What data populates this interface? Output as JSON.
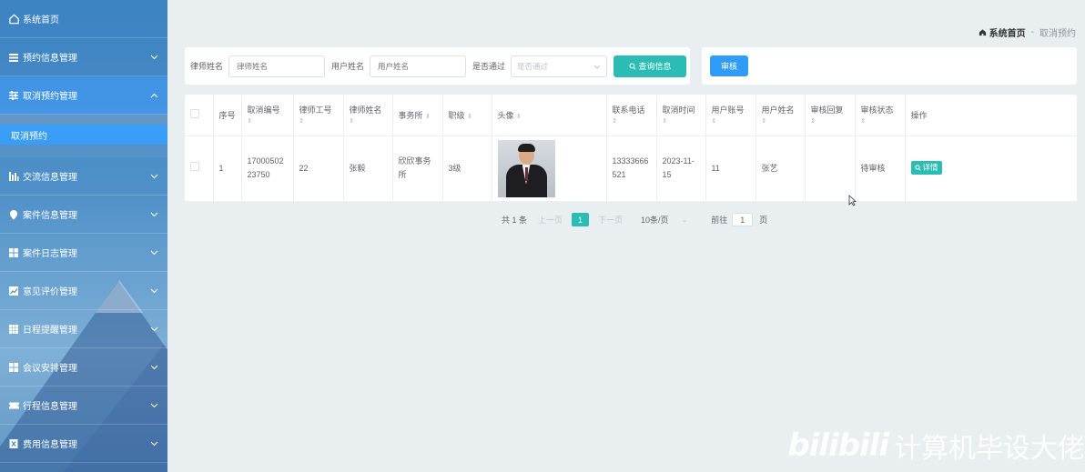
{
  "sidebar": {
    "home": "系统首页",
    "items": [
      {
        "label": "预约信息管理"
      },
      {
        "label": "取消预约管理"
      },
      {
        "label": "交流信息管理"
      },
      {
        "label": "案件信息管理"
      },
      {
        "label": "案件日志管理"
      },
      {
        "label": "意见评价管理"
      },
      {
        "label": "日程提醒管理"
      },
      {
        "label": "会议安排管理"
      },
      {
        "label": "行程信息管理"
      },
      {
        "label": "费用信息管理"
      }
    ],
    "active_sub": "取消预约"
  },
  "breadcrumb": {
    "home": "系统首页",
    "separator": "-",
    "current": "取消预约"
  },
  "search": {
    "lawyer_name_label": "律师姓名",
    "lawyer_name_placeholder": "律师姓名",
    "user_name_label": "用户姓名",
    "user_name_placeholder": "用户姓名",
    "passed_label": "是否通过",
    "passed_placeholder": "是否通过",
    "query_button": "查询信息"
  },
  "actions": {
    "audit_button": "审核"
  },
  "table": {
    "headers": [
      "序号",
      "取消编号",
      "律师工号",
      "律师姓名",
      "事务所",
      "职级",
      "头像",
      "联系电话",
      "取消时间",
      "用户账号",
      "用户姓名",
      "审核回复",
      "审核状态",
      "操作"
    ],
    "rows": [
      {
        "index": "1",
        "cancel_no": "17000502 23750",
        "lawyer_no": "22",
        "lawyer_name": "张毅",
        "firm": "欣欣事务所",
        "rank": "3级",
        "phone": "13333666 521",
        "cancel_time": "2023-11- 15",
        "user_account": "11",
        "user_name": "张艺",
        "audit_reply": "",
        "audit_status": "待审核",
        "detail_button": "详情"
      }
    ]
  },
  "pagination": {
    "total": "共 1 条",
    "prev": "上一页",
    "current_page": "1",
    "next": "下一页",
    "page_size": "10条/页",
    "goto_label": "前往",
    "goto_value": "1",
    "page_suffix": "页"
  },
  "watermark": {
    "logo": "bilibili",
    "text": "计算机毕设大佬"
  },
  "colors": {
    "accent": "#2bbdb3",
    "primary": "#2f9df5",
    "sidebar_active": "#3a9df8"
  }
}
